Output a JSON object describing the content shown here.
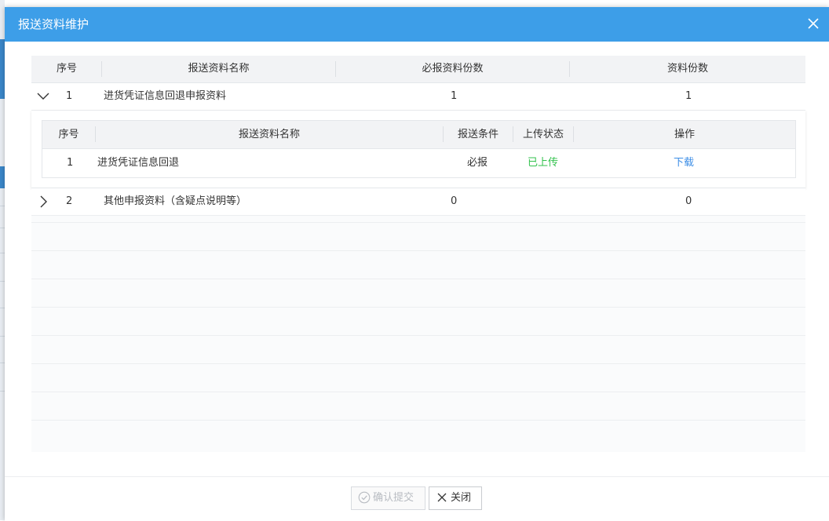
{
  "dialog": {
    "title": "报送资料维护",
    "close_icon": "close-icon"
  },
  "table": {
    "headers": [
      "序号",
      "报送资料名称",
      "必报资料份数",
      "资料份数"
    ],
    "rows": [
      {
        "expanded": true,
        "index": "1",
        "name": "进货凭证信息回退申报资料",
        "required": "1",
        "count": "1"
      },
      {
        "expanded": false,
        "index": "2",
        "name": "其他申报资料（含疑点说明等）",
        "required": "0",
        "count": "0"
      }
    ]
  },
  "subtable": {
    "headers": [
      "序号",
      "报送资料名称",
      "报送条件",
      "上传状态",
      "操作"
    ],
    "rows": [
      {
        "index": "1",
        "name": "进货凭证信息回退",
        "condition": "必报",
        "status": "已上传",
        "action": "下载"
      }
    ]
  },
  "footer": {
    "confirm_label": "确认提交",
    "close_label": "关闭"
  },
  "colors": {
    "titlebar": "#3d9ee8",
    "uploaded": "#33c24d",
    "link": "#3d8ee6"
  }
}
